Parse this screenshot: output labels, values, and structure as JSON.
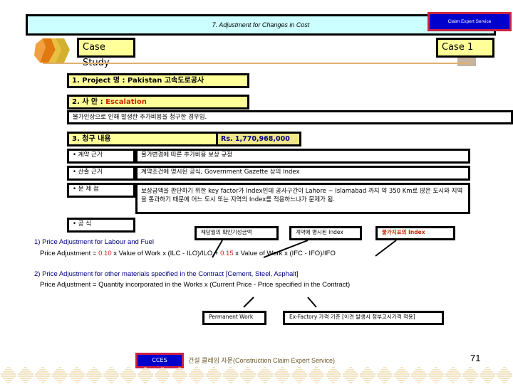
{
  "header": {
    "title": "7. Adjustment for Changes in Cost",
    "badge": "Claim Expert Service",
    "section_label": "Case Study",
    "case_label": "Case 1"
  },
  "project": {
    "label": "1. Project 명 : Pakistan 고속도로공사"
  },
  "issue": {
    "label": "2. 사 안 : ",
    "value": "Escalation",
    "description": "물가인상으로 인해 발생한 추가비용을 청구한 경우임."
  },
  "claim": {
    "label": "3. 청구 내용",
    "amount": "Rs. 1,770,968,000",
    "rows": [
      {
        "label": "• 계약 근거",
        "text": "물가변경에 따른 추가비용 보상 규정"
      },
      {
        "label": "• 산출 근거",
        "text": "계약조건에 명시된 공식, Government Gazette 상의 Index"
      },
      {
        "label": "• 문 제 점",
        "text": "보상금액을 판단하기 위한 key factor가 Index인데 공사구간이 Lahore ~ Islamabad 까지 약 350 Km로 많은 도시와 지역을 통과하기 때문에 어느 도시 또는 지역의 Index를 적용하느냐가 문제가 됨."
      },
      {
        "label": "• 공 식",
        "text": ""
      }
    ]
  },
  "callouts": {
    "monthly": "해당월의 확인기성금액",
    "contract_index": "계약에 명시된 Index",
    "current_index": "물가지표의 Index",
    "permanent": "Permanent Work",
    "ex_factory": "Ex-Factory 가격 기준 [이견 발생시 정부고시가격 적용]"
  },
  "formula1": {
    "heading": "1) Price Adjustment for Labour and Fuel",
    "prefix": "Price Adjustment  = ",
    "coef1": "0.10",
    "mid": " x Value of Work x  (ILC -  ILO)/ILO + ",
    "coef2": "0.15",
    "suffix": " x Value of Work x (IFC - IFO)/IFO"
  },
  "formula2": {
    "heading": "2) Price Adjustment for other materials specified in the Contract [Cement, Steel, Asphalt]",
    "text": "Price Adjustment  = Quantity incorporated in the Works x (Current Price - Price specified in the Contract)"
  },
  "footer": {
    "badge": "CCES",
    "text": "건설 클레임 자문(Construction Claim Expert Service)",
    "page": "71"
  },
  "colors": {
    "title_bg": "#ccffff",
    "label_yellow": "#ffff99",
    "label_khaki": "#f0e68c",
    "badge_blue": "#0000cc",
    "badge_border": "#cc2244",
    "accent_red": "#cc2200"
  }
}
